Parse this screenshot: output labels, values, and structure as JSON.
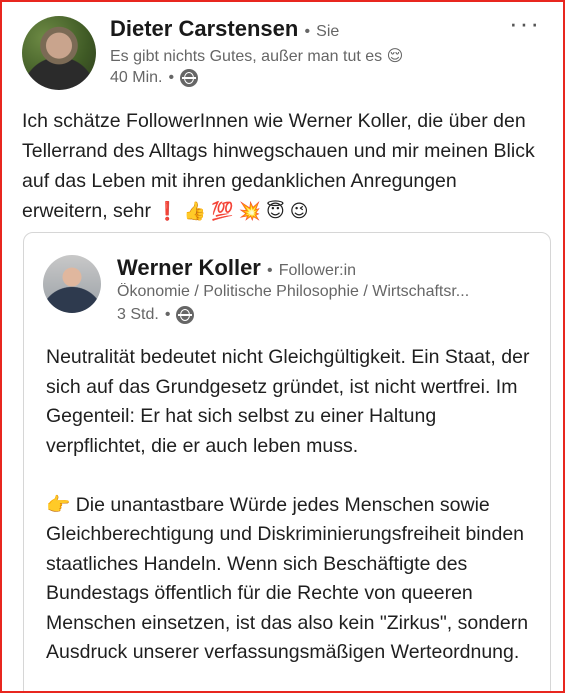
{
  "post": {
    "author": "Dieter Carstensen",
    "author_relation": "Sie",
    "tagline": "Es gibt nichts Gutes, außer man tut es",
    "tagline_emoji": "😌",
    "time": "40 Min.",
    "more_label": "···",
    "text": "Ich schätze FollowerInnen wie Werner Koller, die über den Tellerrand des Alltags hinwegschauen und mir meinen Blick auf das Leben mit ihren gedanklichen Anregungen erweitern, sehr",
    "text_emojis": "❗ 👍 💯 💥 😇 😉"
  },
  "quoted": {
    "author": "Werner Koller",
    "author_relation": "Follower:in",
    "tagline": "Ökonomie / Politische Philosophie / Wirtschaftsr...",
    "time": "3 Std.",
    "paragraph1": "Neutralität bedeutet nicht Gleichgültigkeit. Ein Staat, der sich auf das Grundgesetz gründet, ist nicht wertfrei. Im Gegenteil: Er hat sich selbst zu einer Haltung verpflichtet, die er auch leben muss.",
    "paragraph2_emoji": "👉",
    "paragraph2": "Die unantastbare Würde jedes Menschen sowie Gleichberechtigung und Diskriminierungsfreiheit binden staatliches Handeln. Wenn sich Beschäftigte des Bundestags öffentlich für die Rechte von queeren Menschen einsetzen, ist das also kein \"Zirkus\", sondern Ausdruck unserer verfassungsmäßigen Werteordnung."
  },
  "colors": {
    "frame_border": "#e8261f",
    "muted_text": "#666666"
  },
  "icons": {
    "visibility": "globe-icon",
    "menu": "more-icon"
  }
}
